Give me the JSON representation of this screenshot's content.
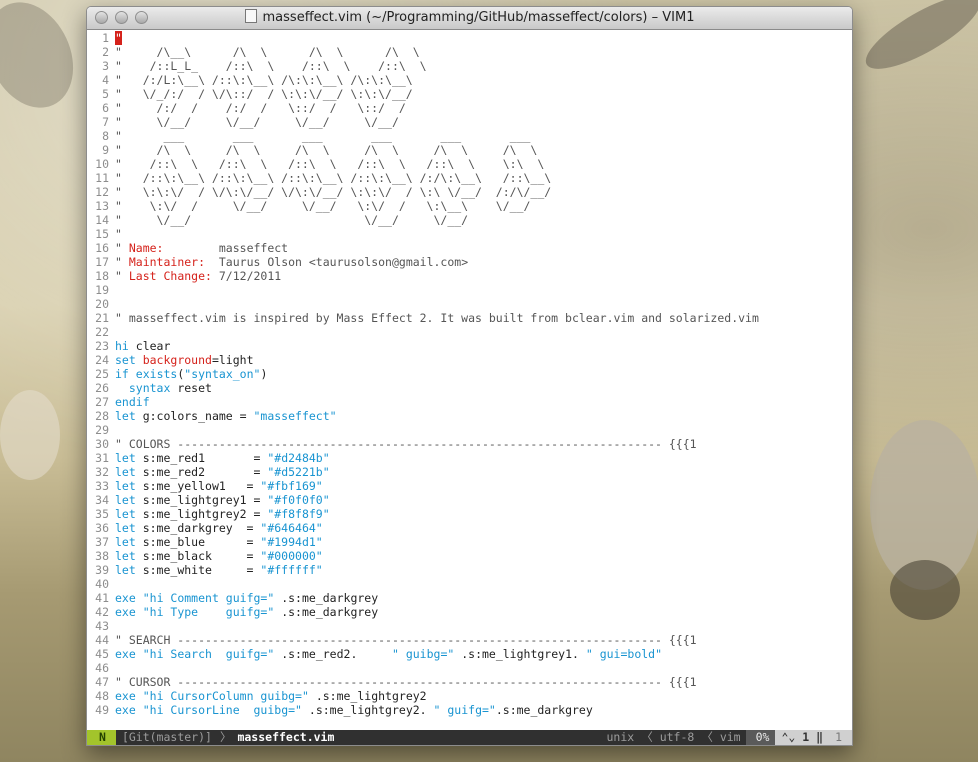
{
  "window": {
    "title": "masseffect.vim (~/Programming/GitHub/masseffect/colors) – VIM1"
  },
  "lines": [
    {
      "n": "1",
      "parts": [
        [
          "cursor",
          "\""
        ]
      ]
    },
    {
      "n": "2",
      "parts": [
        [
          "com",
          "\"     /\\__\\      /\\  \\      /\\  \\      /\\  \\"
        ]
      ]
    },
    {
      "n": "3",
      "parts": [
        [
          "com",
          "\"    /::L_L_    /::\\  \\    /::\\  \\    /::\\  \\"
        ]
      ]
    },
    {
      "n": "4",
      "parts": [
        [
          "com",
          "\"   /:/L:\\__\\ /::\\:\\__\\ /\\:\\:\\__\\ /\\:\\:\\__\\"
        ]
      ]
    },
    {
      "n": "5",
      "parts": [
        [
          "com",
          "\"   \\/_/:/  / \\/\\::/  / \\:\\:\\/__/ \\:\\:\\/__/"
        ]
      ]
    },
    {
      "n": "6",
      "parts": [
        [
          "com",
          "\"     /:/  /    /:/  /   \\::/  /   \\::/  /"
        ]
      ]
    },
    {
      "n": "7",
      "parts": [
        [
          "com",
          "\"     \\/__/     \\/__/     \\/__/     \\/__/"
        ]
      ]
    },
    {
      "n": "8",
      "parts": [
        [
          "com",
          "\"      ___       ___       ___       ___       ___       ___"
        ]
      ]
    },
    {
      "n": "9",
      "parts": [
        [
          "com",
          "\"     /\\  \\     /\\  \\     /\\  \\     /\\  \\     /\\  \\     /\\  \\"
        ]
      ]
    },
    {
      "n": "10",
      "parts": [
        [
          "com",
          "\"    /::\\  \\   /::\\  \\   /::\\  \\   /::\\  \\   /::\\  \\    \\:\\  \\"
        ]
      ]
    },
    {
      "n": "11",
      "parts": [
        [
          "com",
          "\"   /::\\:\\__\\ /::\\:\\__\\ /::\\:\\__\\ /::\\:\\__\\ /:/\\:\\__\\   /::\\__\\"
        ]
      ]
    },
    {
      "n": "12",
      "parts": [
        [
          "com",
          "\"   \\:\\:\\/  / \\/\\:\\/__/ \\/\\:\\/__/ \\:\\:\\/  / \\:\\ \\/__/  /:/\\/__/"
        ]
      ]
    },
    {
      "n": "13",
      "parts": [
        [
          "com",
          "\"    \\:\\/  /     \\/__/     \\/__/   \\:\\/  /   \\:\\__\\    \\/__/"
        ]
      ]
    },
    {
      "n": "14",
      "parts": [
        [
          "com",
          "\"     \\/__/                         \\/__/     \\/__/"
        ]
      ]
    },
    {
      "n": "15",
      "parts": [
        [
          "com",
          "\""
        ]
      ]
    },
    {
      "n": "16",
      "parts": [
        [
          "com",
          "\" "
        ],
        [
          "label",
          "Name:"
        ],
        [
          "com",
          "        masseffect"
        ]
      ]
    },
    {
      "n": "17",
      "parts": [
        [
          "com",
          "\" "
        ],
        [
          "label",
          "Maintainer:"
        ],
        [
          "com",
          "  Taurus Olson <taurusolson@gmail.com>"
        ]
      ]
    },
    {
      "n": "18",
      "parts": [
        [
          "com",
          "\" "
        ],
        [
          "label",
          "Last Change:"
        ],
        [
          "com",
          " 7/12/2011"
        ]
      ]
    },
    {
      "n": "19",
      "parts": [
        [
          "txt",
          ""
        ]
      ]
    },
    {
      "n": "20",
      "parts": [
        [
          "txt",
          ""
        ]
      ]
    },
    {
      "n": "21",
      "parts": [
        [
          "com",
          "\" masseffect.vim is inspired by Mass Effect 2. It was built from bclear.vim and solarized.vim"
        ]
      ]
    },
    {
      "n": "22",
      "parts": [
        [
          "txt",
          ""
        ]
      ]
    },
    {
      "n": "23",
      "parts": [
        [
          "kw",
          "hi"
        ],
        [
          "txt",
          " clear"
        ]
      ]
    },
    {
      "n": "24",
      "parts": [
        [
          "kw",
          "set"
        ],
        [
          "op",
          " background"
        ],
        [
          "txt",
          "=light"
        ]
      ]
    },
    {
      "n": "25",
      "parts": [
        [
          "kw",
          "if"
        ],
        [
          "txt",
          " "
        ],
        [
          "kw",
          "exists"
        ],
        [
          "txt",
          "("
        ],
        [
          "str",
          "\"syntax_on\""
        ],
        [
          "txt",
          ")"
        ]
      ]
    },
    {
      "n": "26",
      "parts": [
        [
          "txt",
          "  "
        ],
        [
          "kw",
          "syntax"
        ],
        [
          "txt",
          " reset"
        ]
      ]
    },
    {
      "n": "27",
      "parts": [
        [
          "kw",
          "endif"
        ]
      ]
    },
    {
      "n": "28",
      "parts": [
        [
          "kw",
          "let"
        ],
        [
          "txt",
          " g:colors_name = "
        ],
        [
          "str",
          "\"masseffect\""
        ]
      ]
    },
    {
      "n": "29",
      "parts": [
        [
          "txt",
          ""
        ]
      ]
    },
    {
      "n": "30",
      "parts": [
        [
          "com",
          "\" COLORS ---------------------------------------------------------------------- {{{1"
        ]
      ]
    },
    {
      "n": "31",
      "parts": [
        [
          "kw",
          "let"
        ],
        [
          "txt",
          " s:me_red1       = "
        ],
        [
          "str",
          "\"#d2484b\""
        ]
      ]
    },
    {
      "n": "32",
      "parts": [
        [
          "kw",
          "let"
        ],
        [
          "txt",
          " s:me_red2       = "
        ],
        [
          "str",
          "\"#d5221b\""
        ]
      ]
    },
    {
      "n": "33",
      "parts": [
        [
          "kw",
          "let"
        ],
        [
          "txt",
          " s:me_yellow1   = "
        ],
        [
          "str",
          "\"#fbf169\""
        ]
      ]
    },
    {
      "n": "34",
      "parts": [
        [
          "kw",
          "let"
        ],
        [
          "txt",
          " s:me_lightgrey1 = "
        ],
        [
          "str",
          "\"#f0f0f0\""
        ]
      ]
    },
    {
      "n": "35",
      "parts": [
        [
          "kw",
          "let"
        ],
        [
          "txt",
          " s:me_lightgrey2 = "
        ],
        [
          "str",
          "\"#f8f8f9\""
        ]
      ]
    },
    {
      "n": "36",
      "parts": [
        [
          "kw",
          "let"
        ],
        [
          "txt",
          " s:me_darkgrey  = "
        ],
        [
          "str",
          "\"#646464\""
        ]
      ]
    },
    {
      "n": "37",
      "parts": [
        [
          "kw",
          "let"
        ],
        [
          "txt",
          " s:me_blue      = "
        ],
        [
          "str",
          "\"#1994d1\""
        ]
      ]
    },
    {
      "n": "38",
      "parts": [
        [
          "kw",
          "let"
        ],
        [
          "txt",
          " s:me_black     = "
        ],
        [
          "str",
          "\"#000000\""
        ]
      ]
    },
    {
      "n": "39",
      "parts": [
        [
          "kw",
          "let"
        ],
        [
          "txt",
          " s:me_white     = "
        ],
        [
          "str",
          "\"#ffffff\""
        ]
      ]
    },
    {
      "n": "40",
      "parts": [
        [
          "txt",
          ""
        ]
      ]
    },
    {
      "n": "41",
      "parts": [
        [
          "kw",
          "exe"
        ],
        [
          "txt",
          " "
        ],
        [
          "str",
          "\"hi Comment guifg=\""
        ],
        [
          "txt",
          " .s:me_darkgrey"
        ]
      ]
    },
    {
      "n": "42",
      "parts": [
        [
          "kw",
          "exe"
        ],
        [
          "txt",
          " "
        ],
        [
          "str",
          "\"hi Type    guifg=\""
        ],
        [
          "txt",
          " .s:me_darkgrey"
        ]
      ]
    },
    {
      "n": "43",
      "parts": [
        [
          "txt",
          ""
        ]
      ]
    },
    {
      "n": "44",
      "parts": [
        [
          "com",
          "\" SEARCH ---------------------------------------------------------------------- {{{1"
        ]
      ]
    },
    {
      "n": "45",
      "parts": [
        [
          "kw",
          "exe"
        ],
        [
          "txt",
          " "
        ],
        [
          "str",
          "\"hi Search  guifg=\""
        ],
        [
          "txt",
          " .s:me_red2.     "
        ],
        [
          "str",
          "\" guibg=\""
        ],
        [
          "txt",
          " .s:me_lightgrey1. "
        ],
        [
          "str",
          "\" gui=bold\""
        ]
      ]
    },
    {
      "n": "46",
      "parts": [
        [
          "txt",
          ""
        ]
      ]
    },
    {
      "n": "47",
      "parts": [
        [
          "com",
          "\" CURSOR ---------------------------------------------------------------------- {{{1"
        ]
      ]
    },
    {
      "n": "48",
      "parts": [
        [
          "kw",
          "exe"
        ],
        [
          "txt",
          " "
        ],
        [
          "str",
          "\"hi CursorColumn guibg=\""
        ],
        [
          "txt",
          " .s:me_lightgrey2"
        ]
      ]
    },
    {
      "n": "49",
      "parts": [
        [
          "kw",
          "exe"
        ],
        [
          "txt",
          " "
        ],
        [
          "str",
          "\"hi CursorLine  guibg=\""
        ],
        [
          "txt",
          " .s:me_lightgrey2. "
        ],
        [
          "str",
          "\" guifg=\""
        ],
        [
          "txt",
          ".s:me_darkgrey"
        ]
      ]
    }
  ],
  "statusline": {
    "mode": "N",
    "branch": "[Git(master)]",
    "sep": "〉",
    "filename": "masseffect.vim",
    "fileformat": "unix",
    "encoding": "utf-8",
    "filetype": "vim",
    "percent": "0%",
    "line_icon": "⌃⌄",
    "line": "1",
    "col_sep": "‖",
    "col": "1"
  }
}
